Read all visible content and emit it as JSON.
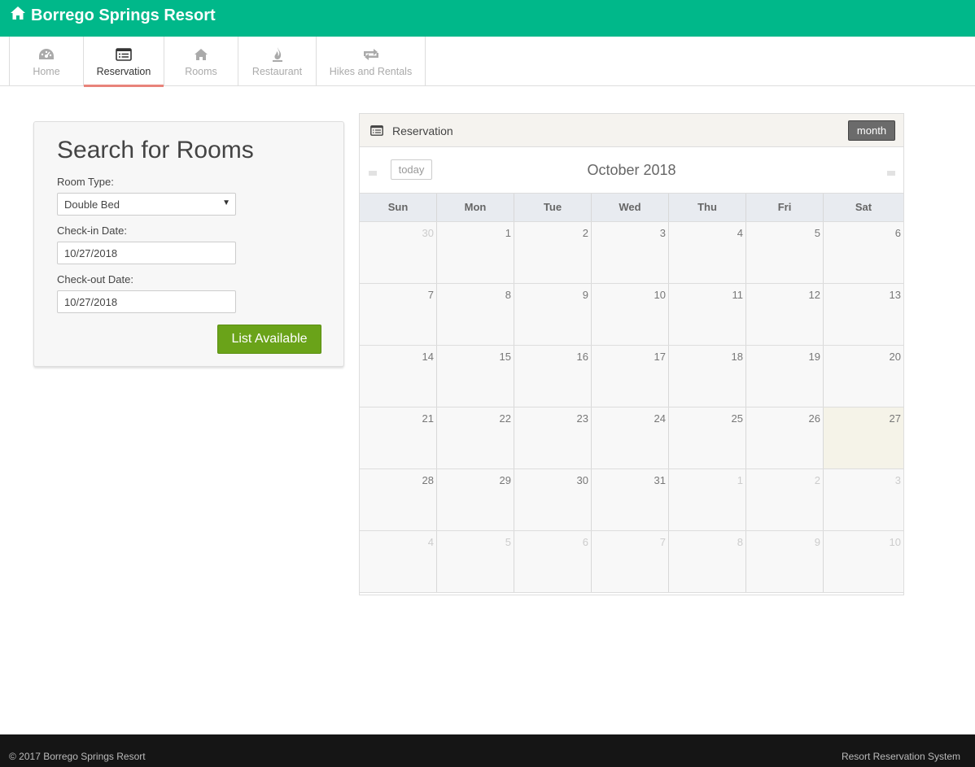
{
  "header": {
    "brand": "Borrego Springs Resort",
    "brand_icon": "home-icon",
    "color": "#00b88a"
  },
  "nav": {
    "items": [
      {
        "label": "Home",
        "icon": "dashboard-icon",
        "active": false
      },
      {
        "label": "Reservation",
        "icon": "list-icon",
        "active": true
      },
      {
        "label": "Rooms",
        "icon": "home-icon",
        "active": false
      },
      {
        "label": "Restaurant",
        "icon": "fire-icon",
        "active": false
      },
      {
        "label": "Hikes and Rentals",
        "icon": "retweet-icon",
        "active": false
      }
    ]
  },
  "search": {
    "title": "Search for Rooms",
    "room_type_label": "Room Type:",
    "room_type_value": "Double Bed",
    "checkin_label": "Check-in Date:",
    "checkin_value": "10/27/2018",
    "checkout_label": "Check-out Date:",
    "checkout_value": "10/27/2018",
    "button_label": "List Available",
    "button_color": "#6aa319"
  },
  "calendar": {
    "panel_title": "Reservation",
    "view_button": "month",
    "today_button": "today",
    "month_title": "October 2018",
    "days_of_week": [
      "Sun",
      "Mon",
      "Tue",
      "Wed",
      "Thu",
      "Fri",
      "Sat"
    ],
    "weeks": [
      [
        {
          "d": "30",
          "o": true
        },
        {
          "d": "1"
        },
        {
          "d": "2"
        },
        {
          "d": "3"
        },
        {
          "d": "4"
        },
        {
          "d": "5"
        },
        {
          "d": "6"
        }
      ],
      [
        {
          "d": "7"
        },
        {
          "d": "8"
        },
        {
          "d": "9"
        },
        {
          "d": "10"
        },
        {
          "d": "11"
        },
        {
          "d": "12"
        },
        {
          "d": "13"
        }
      ],
      [
        {
          "d": "14"
        },
        {
          "d": "15"
        },
        {
          "d": "16"
        },
        {
          "d": "17"
        },
        {
          "d": "18"
        },
        {
          "d": "19"
        },
        {
          "d": "20"
        }
      ],
      [
        {
          "d": "21"
        },
        {
          "d": "22"
        },
        {
          "d": "23"
        },
        {
          "d": "24"
        },
        {
          "d": "25"
        },
        {
          "d": "26"
        },
        {
          "d": "27",
          "t": true
        }
      ],
      [
        {
          "d": "28"
        },
        {
          "d": "29"
        },
        {
          "d": "30"
        },
        {
          "d": "31"
        },
        {
          "d": "1",
          "o": true
        },
        {
          "d": "2",
          "o": true
        },
        {
          "d": "3",
          "o": true
        }
      ],
      [
        {
          "d": "4",
          "o": true
        },
        {
          "d": "5",
          "o": true
        },
        {
          "d": "6",
          "o": true
        },
        {
          "d": "7",
          "o": true
        },
        {
          "d": "8",
          "o": true
        },
        {
          "d": "9",
          "o": true
        },
        {
          "d": "10",
          "o": true
        }
      ]
    ]
  },
  "footer": {
    "left": "© 2017 Borrego Springs Resort",
    "right": "Resort Reservation System"
  }
}
